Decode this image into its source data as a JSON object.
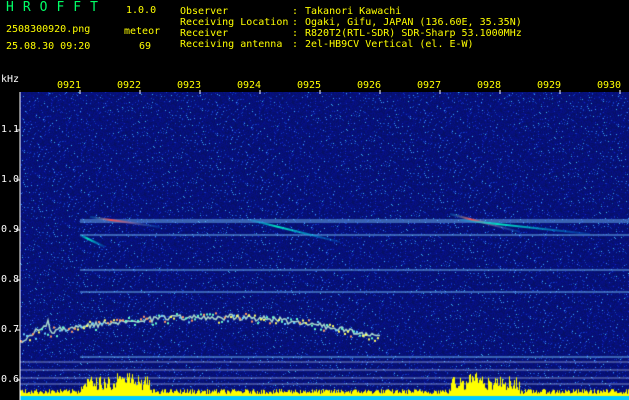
{
  "app": {
    "title": "HROFFT",
    "version": "1.0.0"
  },
  "file": {
    "name": "2508300920.png",
    "datetime": "25.08.30 09:20"
  },
  "meteor": {
    "label": "meteor",
    "count": "69"
  },
  "header": [
    {
      "key": "Observer",
      "sep": ":",
      "value": "Takanori Kawachi"
    },
    {
      "key": "Receiving Location",
      "sep": ":",
      "value": "Ogaki, Gifu, JAPAN (136.60E, 35.35N)"
    },
    {
      "key": "Receiver",
      "sep": ":",
      "value": "R820T2(RTL-SDR) SDR-Sharp 53.1000MHz"
    },
    {
      "key": "Receiving antenna",
      "sep": ":",
      "value": "2el-HB9CV Vertical (el. E-W)"
    }
  ],
  "axis": {
    "y_unit": "kHz",
    "y_ticks": [
      "1.1",
      "1.0",
      "0.9",
      "0.8",
      "0.7",
      "0.6"
    ],
    "x_ticks": [
      "0921",
      "0922",
      "0923",
      "0924",
      "0925",
      "0926",
      "0927",
      "0928",
      "0929",
      "0930"
    ]
  },
  "colors": {
    "background": "#000000",
    "noise": "#0a1a8a",
    "signal": "#00ccff",
    "text_yellow": "#ffff00",
    "title_green": "#00ff66"
  }
}
